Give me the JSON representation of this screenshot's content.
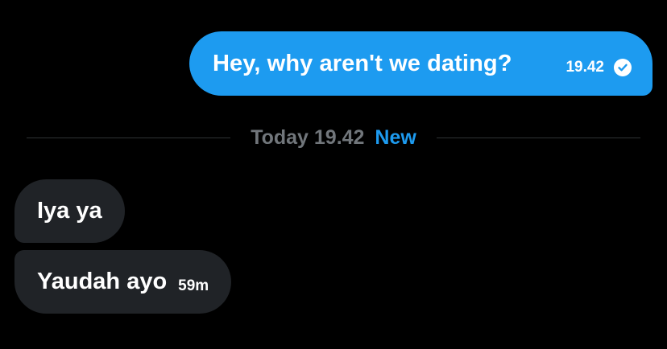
{
  "conversation": {
    "outgoing": {
      "text": "Hey, why aren't we dating?",
      "time": "19.42",
      "status_icon": "check-circle-icon"
    },
    "divider": {
      "label": "Today 19.42",
      "new_label": "New"
    },
    "incoming": [
      {
        "text": "Iya ya",
        "time": ""
      },
      {
        "text": "Yaudah ayo",
        "time": "59m"
      }
    ]
  },
  "colors": {
    "background": "#000000",
    "outgoing_bubble": "#1d9bf0",
    "incoming_bubble": "#202327",
    "muted_text": "#71767b",
    "accent": "#1d9bf0"
  }
}
